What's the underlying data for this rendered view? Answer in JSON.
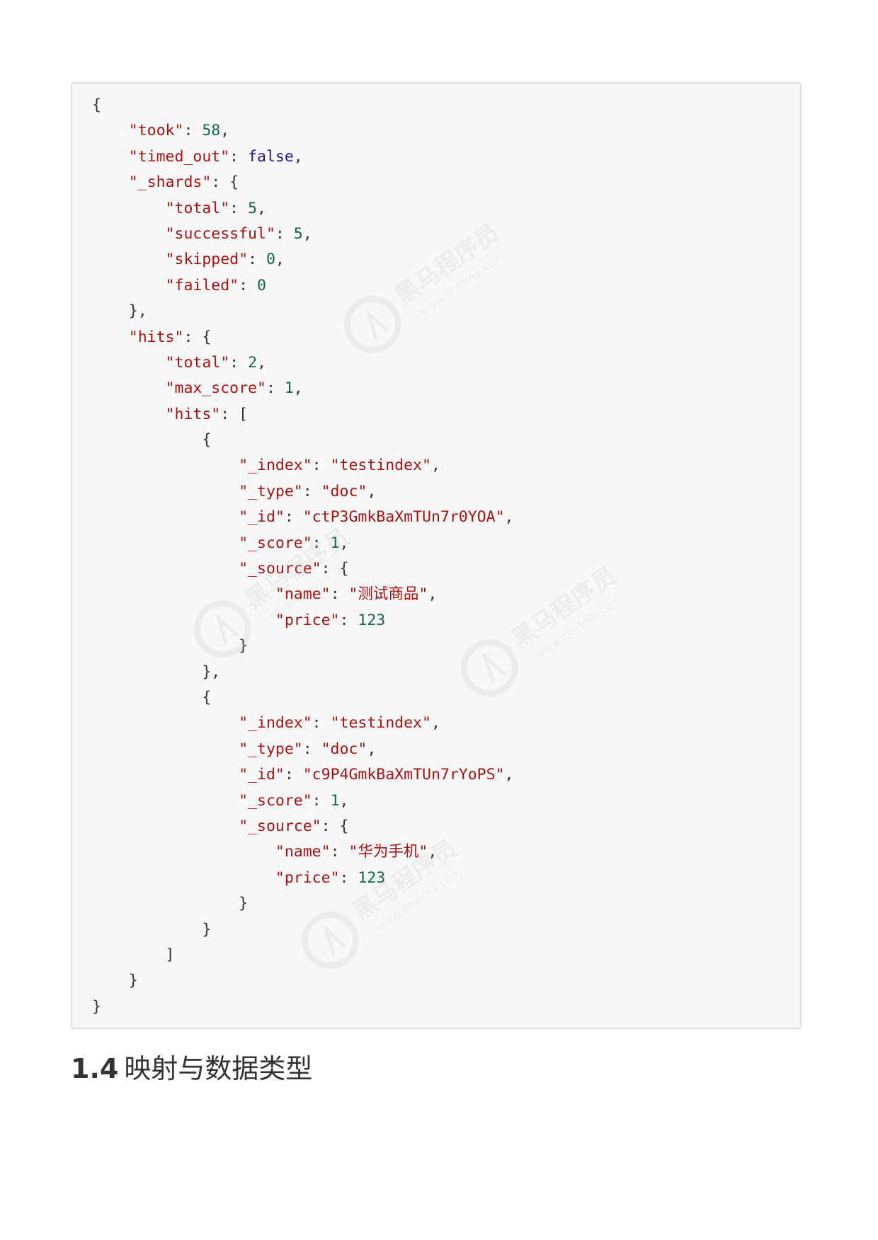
{
  "code_block": {
    "language": "json",
    "lines": [
      [
        {
          "t": "{",
          "c": "punct"
        }
      ],
      [
        {
          "t": "    ",
          "c": "punct"
        },
        {
          "t": "\"took\"",
          "c": "key"
        },
        {
          "t": ": ",
          "c": "punct"
        },
        {
          "t": "58",
          "c": "num"
        },
        {
          "t": ",",
          "c": "punct"
        }
      ],
      [
        {
          "t": "    ",
          "c": "punct"
        },
        {
          "t": "\"timed_out\"",
          "c": "key"
        },
        {
          "t": ": ",
          "c": "punct"
        },
        {
          "t": "false",
          "c": "bool"
        },
        {
          "t": ",",
          "c": "punct"
        }
      ],
      [
        {
          "t": "    ",
          "c": "punct"
        },
        {
          "t": "\"_shards\"",
          "c": "key"
        },
        {
          "t": ": {",
          "c": "punct"
        }
      ],
      [
        {
          "t": "        ",
          "c": "punct"
        },
        {
          "t": "\"total\"",
          "c": "key"
        },
        {
          "t": ": ",
          "c": "punct"
        },
        {
          "t": "5",
          "c": "num"
        },
        {
          "t": ",",
          "c": "punct"
        }
      ],
      [
        {
          "t": "        ",
          "c": "punct"
        },
        {
          "t": "\"successful\"",
          "c": "key"
        },
        {
          "t": ": ",
          "c": "punct"
        },
        {
          "t": "5",
          "c": "num"
        },
        {
          "t": ",",
          "c": "punct"
        }
      ],
      [
        {
          "t": "        ",
          "c": "punct"
        },
        {
          "t": "\"skipped\"",
          "c": "key"
        },
        {
          "t": ": ",
          "c": "punct"
        },
        {
          "t": "0",
          "c": "num"
        },
        {
          "t": ",",
          "c": "punct"
        }
      ],
      [
        {
          "t": "        ",
          "c": "punct"
        },
        {
          "t": "\"failed\"",
          "c": "key"
        },
        {
          "t": ": ",
          "c": "punct"
        },
        {
          "t": "0",
          "c": "num"
        }
      ],
      [
        {
          "t": "    },",
          "c": "punct"
        }
      ],
      [
        {
          "t": "    ",
          "c": "punct"
        },
        {
          "t": "\"hits\"",
          "c": "key"
        },
        {
          "t": ": {",
          "c": "punct"
        }
      ],
      [
        {
          "t": "        ",
          "c": "punct"
        },
        {
          "t": "\"total\"",
          "c": "key"
        },
        {
          "t": ": ",
          "c": "punct"
        },
        {
          "t": "2",
          "c": "num"
        },
        {
          "t": ",",
          "c": "punct"
        }
      ],
      [
        {
          "t": "        ",
          "c": "punct"
        },
        {
          "t": "\"max_score\"",
          "c": "key"
        },
        {
          "t": ": ",
          "c": "punct"
        },
        {
          "t": "1",
          "c": "num"
        },
        {
          "t": ",",
          "c": "punct"
        }
      ],
      [
        {
          "t": "        ",
          "c": "punct"
        },
        {
          "t": "\"hits\"",
          "c": "key"
        },
        {
          "t": ": [",
          "c": "punct"
        }
      ],
      [
        {
          "t": "            {",
          "c": "punct"
        }
      ],
      [
        {
          "t": "                ",
          "c": "punct"
        },
        {
          "t": "\"_index\"",
          "c": "key"
        },
        {
          "t": ": ",
          "c": "punct"
        },
        {
          "t": "\"testindex\"",
          "c": "str"
        },
        {
          "t": ",",
          "c": "punct"
        }
      ],
      [
        {
          "t": "                ",
          "c": "punct"
        },
        {
          "t": "\"_type\"",
          "c": "key"
        },
        {
          "t": ": ",
          "c": "punct"
        },
        {
          "t": "\"doc\"",
          "c": "str"
        },
        {
          "t": ",",
          "c": "punct"
        }
      ],
      [
        {
          "t": "                ",
          "c": "punct"
        },
        {
          "t": "\"_id\"",
          "c": "key"
        },
        {
          "t": ": ",
          "c": "punct"
        },
        {
          "t": "\"ctP3GmkBaXmTUn7r0YOA\"",
          "c": "str"
        },
        {
          "t": ",",
          "c": "punct"
        }
      ],
      [
        {
          "t": "                ",
          "c": "punct"
        },
        {
          "t": "\"_score\"",
          "c": "key"
        },
        {
          "t": ": ",
          "c": "punct"
        },
        {
          "t": "1",
          "c": "num"
        },
        {
          "t": ",",
          "c": "punct"
        }
      ],
      [
        {
          "t": "                ",
          "c": "punct"
        },
        {
          "t": "\"_source\"",
          "c": "key"
        },
        {
          "t": ": {",
          "c": "punct"
        }
      ],
      [
        {
          "t": "                    ",
          "c": "punct"
        },
        {
          "t": "\"name\"",
          "c": "key"
        },
        {
          "t": ": ",
          "c": "punct"
        },
        {
          "t": "\"测试商品\"",
          "c": "str"
        },
        {
          "t": ",",
          "c": "punct"
        }
      ],
      [
        {
          "t": "                    ",
          "c": "punct"
        },
        {
          "t": "\"price\"",
          "c": "key"
        },
        {
          "t": ": ",
          "c": "punct"
        },
        {
          "t": "123",
          "c": "num"
        }
      ],
      [
        {
          "t": "                }",
          "c": "punct"
        }
      ],
      [
        {
          "t": "            },",
          "c": "punct"
        }
      ],
      [
        {
          "t": "            {",
          "c": "punct"
        }
      ],
      [
        {
          "t": "                ",
          "c": "punct"
        },
        {
          "t": "\"_index\"",
          "c": "key"
        },
        {
          "t": ": ",
          "c": "punct"
        },
        {
          "t": "\"testindex\"",
          "c": "str"
        },
        {
          "t": ",",
          "c": "punct"
        }
      ],
      [
        {
          "t": "                ",
          "c": "punct"
        },
        {
          "t": "\"_type\"",
          "c": "key"
        },
        {
          "t": ": ",
          "c": "punct"
        },
        {
          "t": "\"doc\"",
          "c": "str"
        },
        {
          "t": ",",
          "c": "punct"
        }
      ],
      [
        {
          "t": "                ",
          "c": "punct"
        },
        {
          "t": "\"_id\"",
          "c": "key"
        },
        {
          "t": ": ",
          "c": "punct"
        },
        {
          "t": "\"c9P4GmkBaXmTUn7rYoPS\"",
          "c": "str"
        },
        {
          "t": ",",
          "c": "punct"
        }
      ],
      [
        {
          "t": "                ",
          "c": "punct"
        },
        {
          "t": "\"_score\"",
          "c": "key"
        },
        {
          "t": ": ",
          "c": "punct"
        },
        {
          "t": "1",
          "c": "num"
        },
        {
          "t": ",",
          "c": "punct"
        }
      ],
      [
        {
          "t": "                ",
          "c": "punct"
        },
        {
          "t": "\"_source\"",
          "c": "key"
        },
        {
          "t": ": {",
          "c": "punct"
        }
      ],
      [
        {
          "t": "                    ",
          "c": "punct"
        },
        {
          "t": "\"name\"",
          "c": "key"
        },
        {
          "t": ": ",
          "c": "punct"
        },
        {
          "t": "\"华为手机\"",
          "c": "str"
        },
        {
          "t": ",",
          "c": "punct"
        }
      ],
      [
        {
          "t": "                    ",
          "c": "punct"
        },
        {
          "t": "\"price\"",
          "c": "key"
        },
        {
          "t": ": ",
          "c": "punct"
        },
        {
          "t": "123",
          "c": "num"
        }
      ],
      [
        {
          "t": "                }",
          "c": "punct"
        }
      ],
      [
        {
          "t": "            }",
          "c": "punct"
        }
      ],
      [
        {
          "t": "        ]",
          "c": "punct"
        }
      ],
      [
        {
          "t": "    }",
          "c": "punct"
        }
      ],
      [
        {
          "t": "}",
          "c": "punct"
        }
      ]
    ]
  },
  "heading": {
    "number": "1.4",
    "title": "映射与数据类型"
  },
  "watermark": {
    "brand": "黑马程序员",
    "url": "www.itheima.com",
    "icon": "itheima-logo-icon"
  },
  "colors": {
    "key": "#aa1111",
    "string": "#aa1111",
    "number": "#116644",
    "boolean": "#221199",
    "punctuation": "#333333",
    "code_background": "#f8f8f8",
    "code_border": "#e0e0e0"
  }
}
